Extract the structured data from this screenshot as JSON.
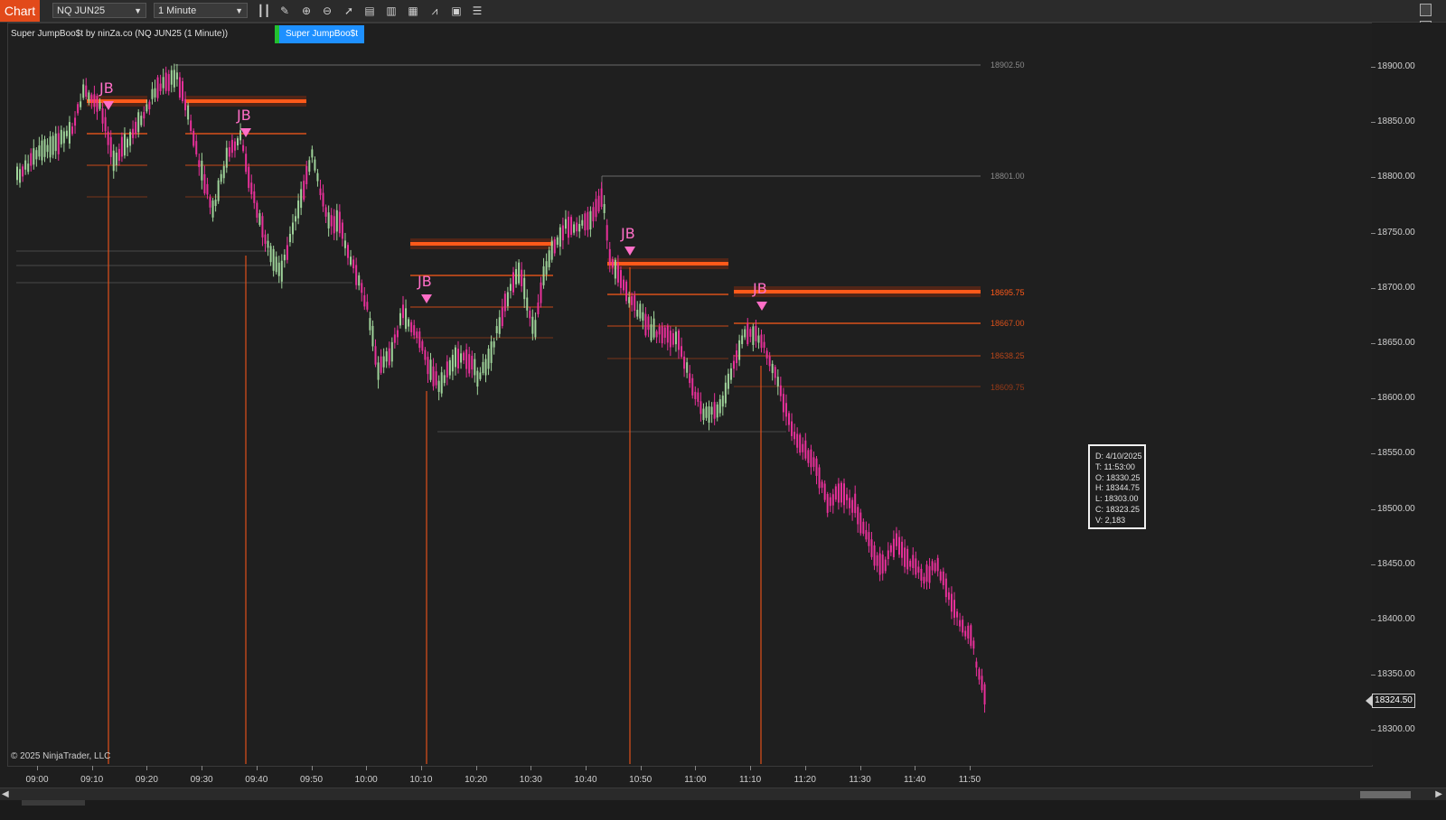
{
  "app": {
    "title": "Chart"
  },
  "toolbar": {
    "instrument": "NQ JUN25",
    "interval": "1 Minute",
    "tools": [
      "bars-type-icon",
      "pencil-icon",
      "zoom-in-icon",
      "zoom-out-icon",
      "pointer-icon",
      "data-box-icon",
      "properties-icon",
      "strategies-icon",
      "indicators-icon",
      "templates-icon",
      "list-icon"
    ]
  },
  "chart": {
    "indicator_label": "Super JumpBoo$t by ninZa.co (NQ JUN25 (1 Minute))",
    "indicator_button": "Super JumpBoo$t",
    "copyright": "© 2025 NinjaTrader, LLC",
    "signal_label": "JB",
    "current_price": "18324.50",
    "price_axis_labels": [
      "18900.00",
      "18850.00",
      "18800.00",
      "18750.00",
      "18700.00",
      "18650.00",
      "18600.00",
      "18550.00",
      "18500.00",
      "18450.00",
      "18400.00",
      "18350.00",
      "18300.00"
    ],
    "time_axis_labels": [
      "09:00",
      "09:10",
      "09:20",
      "09:30",
      "09:40",
      "09:50",
      "10:00",
      "10:10",
      "10:20",
      "10:30",
      "10:40",
      "10:50",
      "11:00",
      "11:10",
      "11:20",
      "11:30",
      "11:40",
      "11:50"
    ],
    "level_labels": {
      "high_1": "18902.50",
      "high_2": "18801.00",
      "lvl_a": "18695.75",
      "lvl_b": "18667.00",
      "lvl_c": "18638.25",
      "lvl_d": "18609.75"
    },
    "colors": {
      "up": "#9fd39a",
      "down": "#e8309a",
      "level": "#ff5a1a",
      "signal": "#ff6ec7"
    }
  },
  "data_box": {
    "lines": [
      "D:  4/10/2025",
      "T:  11:53:00",
      "O:  18330.25",
      "H:  18344.75",
      "L:  18303.00",
      "C:  18323.25",
      "V:  2,183"
    ]
  }
}
